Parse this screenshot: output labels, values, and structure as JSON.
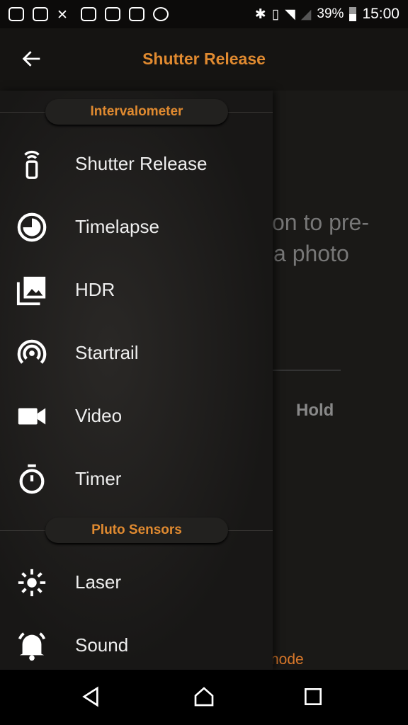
{
  "status_bar": {
    "battery": "39%",
    "time": "15:00",
    "icons": [
      "messages-icon",
      "facebook-icon",
      "missed-call-icon",
      "instagram-icon",
      "instagram-icon",
      "outlook-icon",
      "xl-icon",
      "bluetooth-icon",
      "vibrate-icon",
      "wifi-icon",
      "signal-icon",
      "battery-icon"
    ]
  },
  "appbar": {
    "title": "Shutter Release"
  },
  "background": {
    "text_line1": "on to pre-",
    "text_line2": "a photo",
    "hold": "Hold",
    "mode": "node"
  },
  "drawer": {
    "sections": [
      {
        "label": "Intervalometer",
        "items": [
          {
            "label": "Shutter Release",
            "icon": "remote-icon"
          },
          {
            "label": "Timelapse",
            "icon": "clock-icon"
          },
          {
            "label": "HDR",
            "icon": "photos-icon"
          },
          {
            "label": "Startrail",
            "icon": "broadcast-icon"
          },
          {
            "label": "Video",
            "icon": "video-icon"
          },
          {
            "label": "Timer",
            "icon": "stopwatch-icon"
          }
        ]
      },
      {
        "label": "Pluto Sensors",
        "items": [
          {
            "label": "Laser",
            "icon": "laser-icon"
          },
          {
            "label": "Sound",
            "icon": "bell-icon"
          }
        ]
      }
    ]
  },
  "colors": {
    "accent": "#e08a30"
  }
}
